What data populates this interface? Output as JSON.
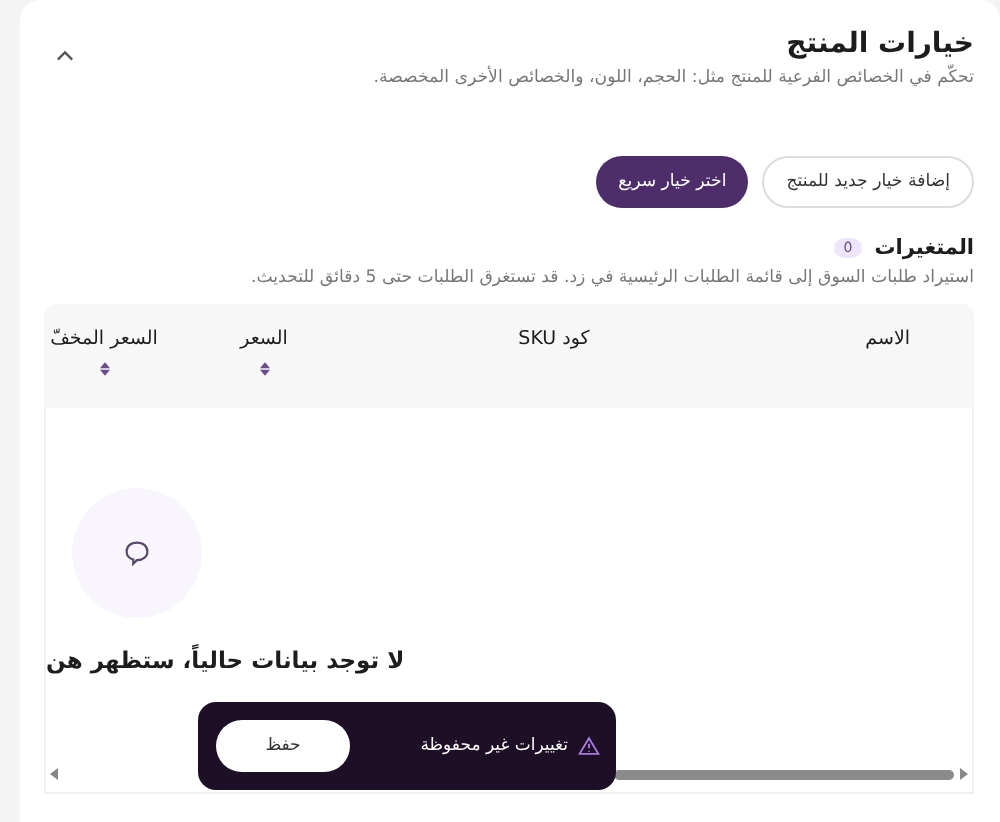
{
  "section": {
    "title": "خيارات المنتج",
    "description": "تحكّم في الخصائص الفرعية للمنتج مثل: الحجم، اللون، والخصائص الأخرى المخصصة.",
    "expanded": true
  },
  "actions": [
    {
      "label": "إضافة خيار جديد للمنتج",
      "kind": "secondary"
    },
    {
      "label": "اختر خيار سريع",
      "kind": "primary"
    }
  ],
  "variants": {
    "title": "المتغيرات",
    "count": "0",
    "description": "استيراد طلبات السوق إلى قائمة الطلبات الرئيسية في زد. قد تستغرق الطلبات حتى 5 دقائق للتحديث."
  },
  "table": {
    "columns": [
      {
        "label": "الاسم",
        "sortable": false
      },
      {
        "label": "كود SKU",
        "sortable": false
      },
      {
        "label": "السعر",
        "sortable": true
      },
      {
        "label": "السعر المخفّ",
        "sortable": true
      }
    ],
    "empty_message": "لا توجد بيانات حالياً، ستظهر هن"
  },
  "toast": {
    "message": "تغييرات غير محفوظة",
    "button": "حفظ"
  }
}
